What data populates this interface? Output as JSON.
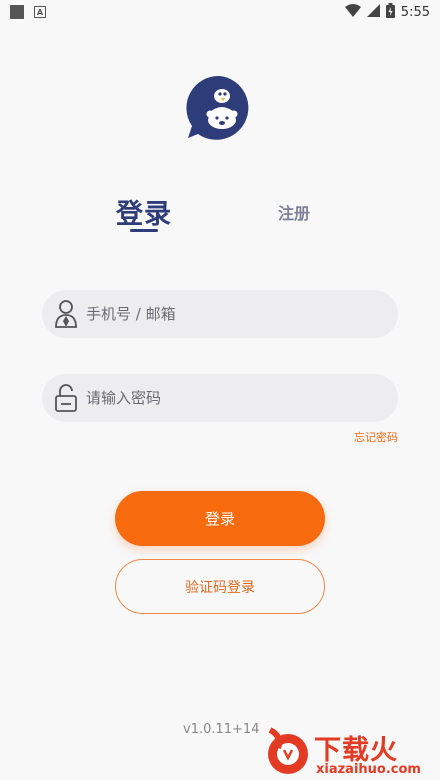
{
  "status_bar": {
    "time": "5:55"
  },
  "tabs": {
    "login": "登录",
    "register": "注册"
  },
  "form": {
    "phone_placeholder": "手机号 / 邮箱",
    "password_placeholder": "请输入密码",
    "forgot_password": "忘记密码"
  },
  "buttons": {
    "login": "登录",
    "sms_login": "验证码登录"
  },
  "version": "v1.0.11+14",
  "watermark": {
    "brand": "下载火",
    "domain": "xiazaihuo.com"
  },
  "colors": {
    "accent": "#f76b0e",
    "brand_blue": "#2e3d7a"
  }
}
